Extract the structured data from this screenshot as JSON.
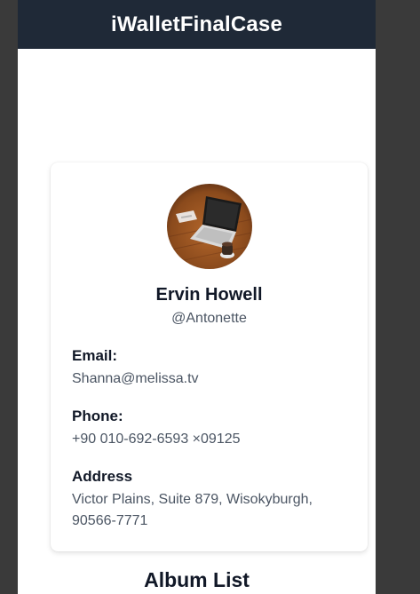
{
  "app": {
    "title": "iWalletFinalCase"
  },
  "profile": {
    "avatar_icon": "laptop-photo",
    "name": "Ervin Howell",
    "username": "@Antonette",
    "email_label": "Email:",
    "email": "Shanna@melissa.tv",
    "phone_label": "Phone:",
    "phone": "+90 010-692-6593 ×09125",
    "address_label": "Address",
    "address": "Victor Plains, Suite 879, Wisokyburgh, 90566-7771"
  },
  "albums": {
    "title": "Album List"
  },
  "colors": {
    "header_bg": "#1f2937",
    "page_bg": "#ffffff",
    "text_primary": "#111827",
    "text_secondary": "#4b5563"
  }
}
